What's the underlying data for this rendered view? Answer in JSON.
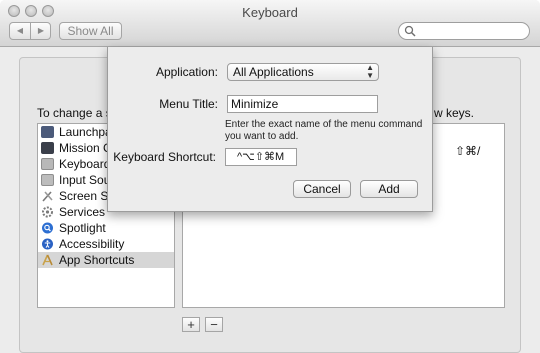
{
  "window": {
    "title": "Keyboard"
  },
  "toolbar": {
    "back_icon": "chevron-left-icon",
    "forward_icon": "chevron-right-icon",
    "show_all_label": "Show All",
    "search_icon": "search-icon",
    "search_value": ""
  },
  "content": {
    "instruction_left": "To change a s",
    "instruction_right": "w keys.",
    "shortcut_glyphs": "⇧⌘/"
  },
  "categories": [
    {
      "label": "Launchpad",
      "icon": "launchpad-icon",
      "color": "#4b5a7a"
    },
    {
      "label": "Mission C",
      "icon": "mission-control-icon",
      "color": "#3a3f4a"
    },
    {
      "label": "Keyboard",
      "icon": "keyboard-icon",
      "color": "#b8b8b8"
    },
    {
      "label": "Input Sou",
      "icon": "input-sources-icon",
      "color": "#bcbcbc"
    },
    {
      "label": "Screen Sh",
      "icon": "screenshot-icon",
      "color": "#9a9a9a"
    },
    {
      "label": "Services",
      "icon": "gear-icon",
      "color": "#8a8a8a"
    },
    {
      "label": "Spotlight",
      "icon": "spotlight-icon",
      "color": "#2d6fd2"
    },
    {
      "label": "Accessibility",
      "icon": "accessibility-icon",
      "color": "#2a62c4"
    },
    {
      "label": "App Shortcuts",
      "icon": "app-shortcuts-icon",
      "color": "#c9a24a",
      "selected": true
    }
  ],
  "buttons": {
    "add_label": "+",
    "remove_label": "−"
  },
  "sheet": {
    "application_label": "Application:",
    "application_value": "All Applications",
    "menu_title_label": "Menu Title:",
    "menu_title_value": "Minimize",
    "help_text": "Enter the exact name of the menu command you want to add.",
    "shortcut_label": "Keyboard Shortcut:",
    "shortcut_value": "^⌥⇧⌘M",
    "cancel_label": "Cancel",
    "add_label": "Add"
  }
}
